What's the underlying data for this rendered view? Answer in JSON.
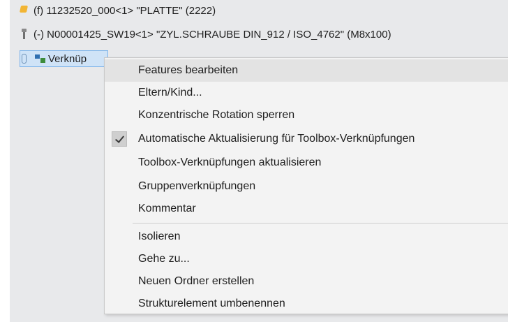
{
  "tree": {
    "rows": [
      {
        "label": "(f) 11232520_000<1> \"PLATTE\" (2222)",
        "icon": "part-icon"
      },
      {
        "label": "(-) N00001425_SW19<1> \"ZYL.SCHRAUBE DIN_912 / ISO_4762\" (M8x100)",
        "icon": "screw-icon"
      },
      {
        "label": "Verknüp",
        "icon": "mates-icon"
      }
    ]
  },
  "context_menu": {
    "items": [
      {
        "label": "Features bearbeiten",
        "highlighted": true
      },
      {
        "label": "Eltern/Kind..."
      },
      {
        "label": "Konzentrische Rotation sperren"
      },
      {
        "label": "Automatische Aktualisierung für Toolbox-Verknüpfungen",
        "checked": true
      },
      {
        "label": "Toolbox-Verknüpfungen aktualisieren"
      },
      {
        "label": "Gruppenverknüpfungen"
      },
      {
        "label": "Kommentar"
      },
      {
        "label": "Isolieren"
      },
      {
        "label": "Gehe zu..."
      },
      {
        "label": "Neuen Ordner erstellen"
      },
      {
        "label": "Strukturelement umbenennen"
      }
    ]
  },
  "colors": {
    "menu_background": "#f3f3f3",
    "highlight": "#e3e3e3",
    "selection": "#cfe3f7",
    "tree_background": "#e8e9eb"
  }
}
